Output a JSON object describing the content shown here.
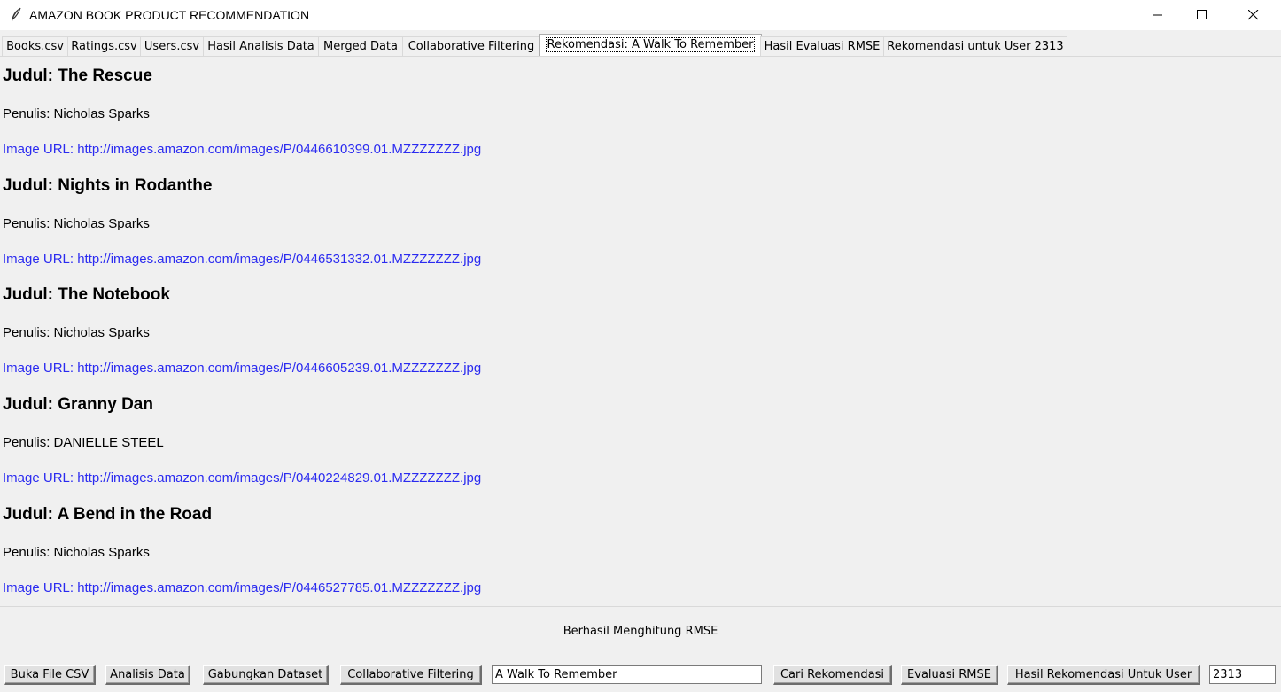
{
  "window": {
    "title": "AMAZON BOOK PRODUCT RECOMMENDATION",
    "icon": "feather-icon",
    "controls": [
      "minimize-icon",
      "maximize-icon",
      "close-icon"
    ]
  },
  "tabs": [
    {
      "label": "Books.csv",
      "active": false
    },
    {
      "label": "Ratings.csv",
      "active": false
    },
    {
      "label": "Users.csv",
      "active": false
    },
    {
      "label": "Hasil Analisis Data",
      "active": false
    },
    {
      "label": "Merged Data",
      "active": false
    },
    {
      "label": "Collaborative Filtering",
      "active": false
    },
    {
      "label": "Rekomendasi: A Walk To Remember",
      "active": true
    },
    {
      "label": "Hasil Evaluasi RMSE",
      "active": false
    },
    {
      "label": "Rekomendasi untuk User 2313",
      "active": false
    }
  ],
  "books": [
    {
      "title": "Judul: The Rescue",
      "author": "Penulis: Nicholas Sparks",
      "image_url": "Image URL: http://images.amazon.com/images/P/0446610399.01.MZZZZZZZ.jpg"
    },
    {
      "title": "Judul: Nights in Rodanthe",
      "author": "Penulis: Nicholas Sparks",
      "image_url": "Image URL: http://images.amazon.com/images/P/0446531332.01.MZZZZZZZ.jpg"
    },
    {
      "title": "Judul: The Notebook",
      "author": "Penulis: Nicholas Sparks",
      "image_url": "Image URL: http://images.amazon.com/images/P/0446605239.01.MZZZZZZZ.jpg"
    },
    {
      "title": "Judul: Granny Dan",
      "author": "Penulis: DANIELLE STEEL",
      "image_url": "Image URL: http://images.amazon.com/images/P/0440224829.01.MZZZZZZZ.jpg"
    },
    {
      "title": "Judul: A Bend in the Road",
      "author": "Penulis: Nicholas Sparks",
      "image_url": "Image URL: http://images.amazon.com/images/P/0446527785.01.MZZZZZZZ.jpg"
    }
  ],
  "status": "Berhasil Menghitung RMSE",
  "toolbar": {
    "open_csv": "Buka File CSV",
    "analyze": "Analisis Data",
    "merge": "Gabungkan Dataset",
    "cf": "Collaborative Filtering",
    "book_input_value": "A Walk To Remember",
    "search": "Cari Rekomendasi",
    "evaluate": "Evaluasi RMSE",
    "user_rec": "Hasil Rekomendasi Untuk User",
    "user_input_value": "2313"
  },
  "colors": {
    "link": "#2b2bf0",
    "background": "#f0f0f0"
  }
}
